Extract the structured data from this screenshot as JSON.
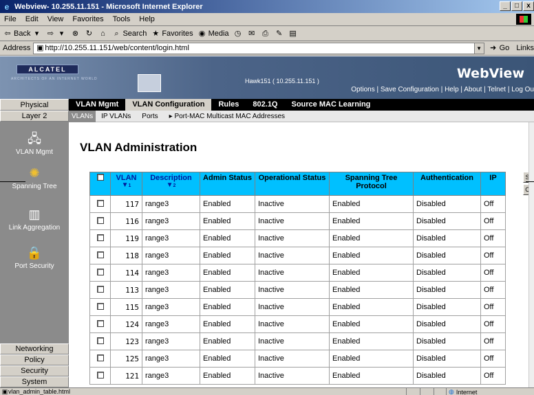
{
  "window": {
    "title": "Webview- 10.255.11.151 - Microsoft Internet Explorer",
    "controls": [
      "_",
      "□",
      "x"
    ]
  },
  "menu": [
    "File",
    "Edit",
    "View",
    "Favorites",
    "Tools",
    "Help"
  ],
  "toolbar": {
    "back": "Back",
    "search": "Search",
    "favorites": "Favorites",
    "media": "Media"
  },
  "address": {
    "label": "Address",
    "url": "http://10.255.11.151/web/content/login.html",
    "go": "Go",
    "links": "Links"
  },
  "banner": {
    "logo": "ALCATEL",
    "logo_tagline": "ARCHITECTS OF AN INTERNET WORLD",
    "host": "Hawk151  ( 10.255.11.151 )",
    "title": "WebView",
    "links": "Options | Save Configuration | Help | About | Telnet | Log Ou"
  },
  "topnav": {
    "category": "Physical",
    "tabs": [
      "VLAN Mgmt",
      "VLAN Configuration",
      "Rules",
      "802.1Q",
      "Source MAC Learning"
    ],
    "active_tab": "VLAN Configuration"
  },
  "sidebar": {
    "category": "Layer 2",
    "items": [
      "VLAN Mgmt",
      "Spanning Tree",
      "Link Aggregation",
      "Port Security"
    ],
    "bottom": [
      "Networking",
      "Policy",
      "Security",
      "System"
    ]
  },
  "subnav": [
    "VLANs",
    "IP VLANs",
    "Ports",
    "Port-MAC Multicast MAC Addresses"
  ],
  "page": {
    "title": "VLAN Administration"
  },
  "table": {
    "headers": {
      "vlan": "VLAN",
      "description": "Description",
      "admin": "Admin Status",
      "oper": "Operational Status",
      "stp": "Spanning Tree Protocol",
      "auth": "Authentication",
      "ip": "IP"
    },
    "sort_indicators": [
      "1",
      "2"
    ],
    "rows": [
      {
        "vlan": "117",
        "description": "range3",
        "admin": "Enabled",
        "oper": "Inactive",
        "stp": "Enabled",
        "auth": "Disabled",
        "ip": "Off"
      },
      {
        "vlan": "116",
        "description": "range3",
        "admin": "Enabled",
        "oper": "Inactive",
        "stp": "Enabled",
        "auth": "Disabled",
        "ip": "Off"
      },
      {
        "vlan": "119",
        "description": "range3",
        "admin": "Enabled",
        "oper": "Inactive",
        "stp": "Enabled",
        "auth": "Disabled",
        "ip": "Off"
      },
      {
        "vlan": "118",
        "description": "range3",
        "admin": "Enabled",
        "oper": "Inactive",
        "stp": "Enabled",
        "auth": "Disabled",
        "ip": "Off"
      },
      {
        "vlan": "114",
        "description": "range3",
        "admin": "Enabled",
        "oper": "Inactive",
        "stp": "Enabled",
        "auth": "Disabled",
        "ip": "Off"
      },
      {
        "vlan": "113",
        "description": "range3",
        "admin": "Enabled",
        "oper": "Inactive",
        "stp": "Enabled",
        "auth": "Disabled",
        "ip": "Off"
      },
      {
        "vlan": "115",
        "description": "range3",
        "admin": "Enabled",
        "oper": "Inactive",
        "stp": "Enabled",
        "auth": "Disabled",
        "ip": "Off"
      },
      {
        "vlan": "124",
        "description": "range3",
        "admin": "Enabled",
        "oper": "Inactive",
        "stp": "Enabled",
        "auth": "Disabled",
        "ip": "Off"
      },
      {
        "vlan": "123",
        "description": "range3",
        "admin": "Enabled",
        "oper": "Inactive",
        "stp": "Enabled",
        "auth": "Disabled",
        "ip": "Off"
      },
      {
        "vlan": "125",
        "description": "range3",
        "admin": "Enabled",
        "oper": "Inactive",
        "stp": "Enabled",
        "auth": "Disabled",
        "ip": "Off"
      },
      {
        "vlan": "121",
        "description": "range3",
        "admin": "Enabled",
        "oper": "Inactive",
        "stp": "Enabled",
        "auth": "Disabled",
        "ip": "Off"
      }
    ],
    "side_buttons": [
      "S",
      "C"
    ]
  },
  "status": {
    "left": "vlan_admin_table.html",
    "zone": "Internet"
  },
  "colors": {
    "header_bg": "#00c0ff",
    "sidebar_bg": "#8b8b8b",
    "nav_bg": "#000000"
  }
}
